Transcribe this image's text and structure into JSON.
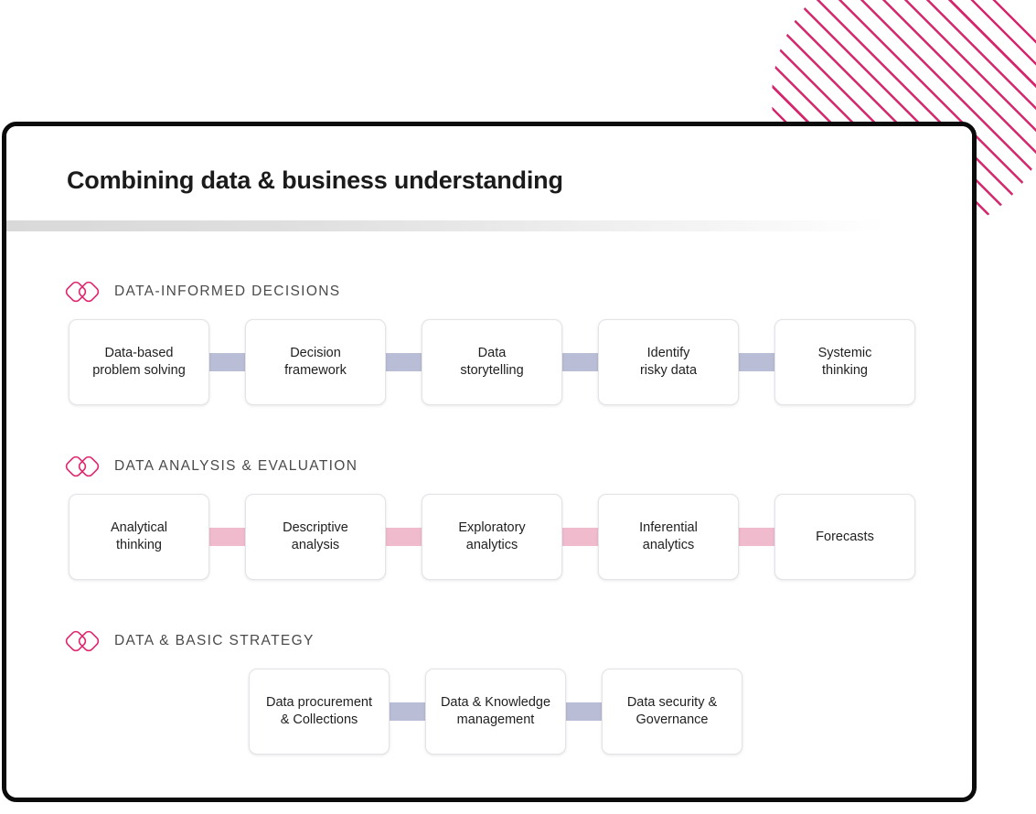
{
  "page": {
    "title": "Combining data & business understanding",
    "accent_pink": "#d6276e",
    "connector_lavender": "#b9bdd5",
    "connector_pink": "#f1bbce",
    "card_border": "#0b0b0b"
  },
  "decoration": {
    "striped_circle": "striped-circle-decoration"
  },
  "sections": [
    {
      "icon": "overlapping-diamonds-icon",
      "label": "DATA-INFORMED DECISIONS",
      "connector_color": "lavender",
      "nodes": [
        {
          "line1": "Data-based",
          "line2": "problem solving"
        },
        {
          "line1": "Decision",
          "line2": "framework"
        },
        {
          "line1": "Data",
          "line2": "storytelling"
        },
        {
          "line1": "Identify",
          "line2": "risky data"
        },
        {
          "line1": "Systemic",
          "line2": "thinking"
        }
      ]
    },
    {
      "icon": "overlapping-diamonds-icon",
      "label": "DATA ANALYSIS & EVALUATION",
      "connector_color": "pink",
      "nodes": [
        {
          "line1": "Analytical",
          "line2": "thinking"
        },
        {
          "line1": "Descriptive",
          "line2": "analysis"
        },
        {
          "line1": "Exploratory",
          "line2": "analytics"
        },
        {
          "line1": "Inferential",
          "line2": "analytics"
        },
        {
          "line1": "Forecasts",
          "line2": ""
        }
      ]
    },
    {
      "icon": "overlapping-diamonds-icon",
      "label": "DATA & BASIC STRATEGY",
      "connector_color": "lavender",
      "nodes": [
        {
          "line1": "Data procurement",
          "line2": "& Collections"
        },
        {
          "line1": "Data & Knowledge",
          "line2": "management"
        },
        {
          "line1": "Data security &",
          "line2": "Governance"
        }
      ]
    }
  ]
}
